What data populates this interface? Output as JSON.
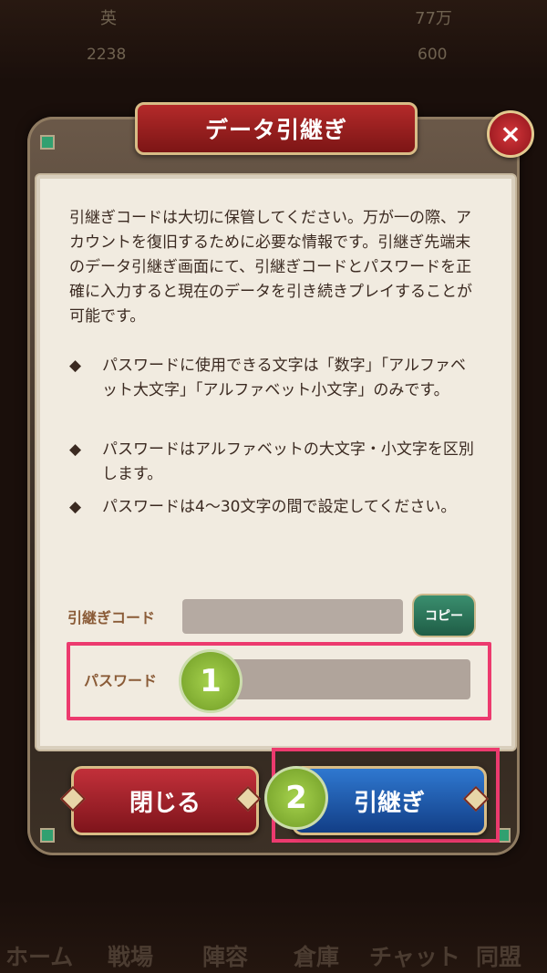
{
  "background": {
    "stats_row1": [
      "英",
      "77万"
    ],
    "stats_row2": [
      "2238",
      "600"
    ],
    "bottom_nav": [
      "ホーム",
      "戦場",
      "陣容",
      "倉庫",
      "チャット",
      "同盟"
    ]
  },
  "dialog": {
    "title": "データ引継ぎ",
    "close_icon": "×",
    "intro": "引継ぎコードは大切に保管してください。万が一の際、アカウントを復旧するために必要な情報です。引継ぎ先端末のデータ引継ぎ画面にて、引継ぎコードとパスワードを正確に入力すると現在のデータを引き続きプレイすることが可能です。",
    "bullet_symbol": "◆",
    "bullets": [
      "パスワードに使用できる文字は「数字」「アルファベット大文字」「アルファベット小文字」のみです。",
      "パスワードはアルファベットの大文字・小文字を区別します。",
      "パスワードは4～30文字の間で設定してください。"
    ],
    "code_label": "引継ぎコード",
    "copy_label": "コピー",
    "password_label": "パスワード",
    "close_button": "閉じる",
    "transfer_button": "引継ぎ"
  },
  "annotations": {
    "step1": "1",
    "step2": "2",
    "highlight_color": "#ec3a6e",
    "step_color": "#8bb93a"
  }
}
